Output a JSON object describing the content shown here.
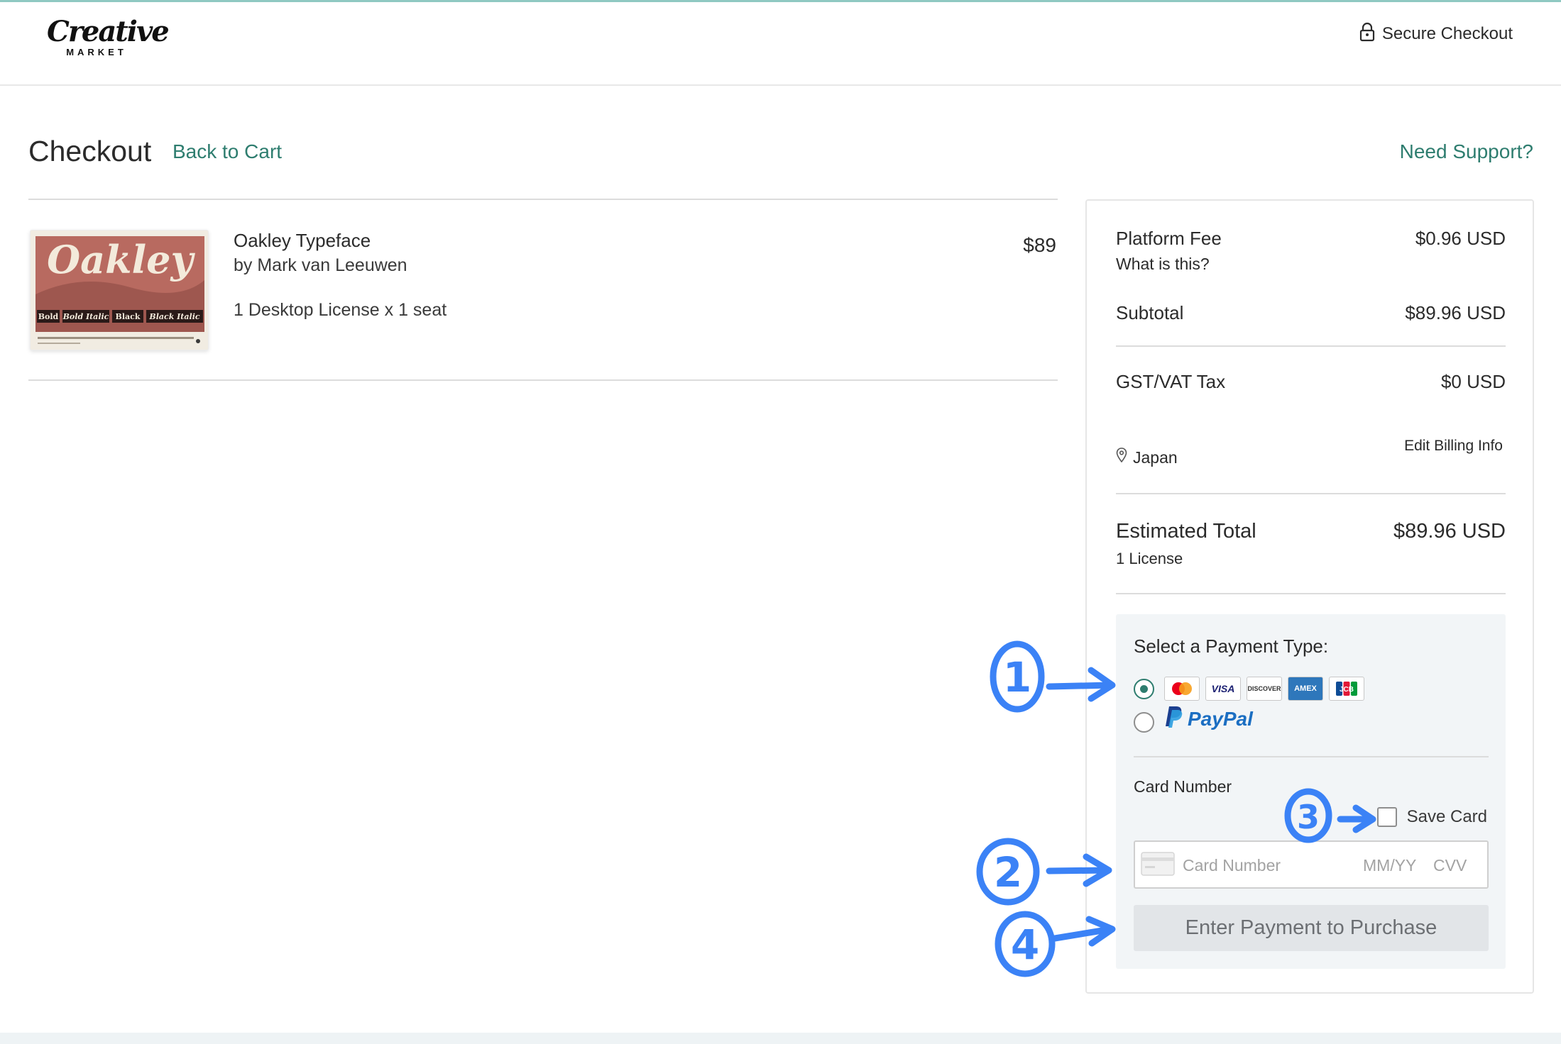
{
  "header": {
    "logo_main": "Creative",
    "logo_sub": "MARKET",
    "secure_label": "Secure Checkout"
  },
  "checkout": {
    "title": "Checkout",
    "back_link": "Back to Cart",
    "support_link": "Need Support?"
  },
  "item": {
    "name": "Oakley Typeface",
    "author": "by Mark van Leeuwen",
    "license": "1 Desktop License x 1 seat",
    "price": "$89",
    "thumbnail": {
      "title": "Oakley",
      "styles": [
        "Bold",
        "Bold Italic",
        "Black",
        "Black Italic"
      ]
    }
  },
  "summary": {
    "platform_fee_label": "Platform Fee",
    "platform_fee_value": "$0.96 USD",
    "what_is_this": "What is this?",
    "subtotal_label": "Subtotal",
    "subtotal_value": "$89.96 USD",
    "tax_label": "GST/VAT Tax",
    "tax_value": "$0 USD",
    "location": "Japan",
    "edit_billing": "Edit Billing Info",
    "total_label": "Estimated Total",
    "total_value": "$89.96 USD",
    "license_count": "1 License"
  },
  "payment": {
    "title": "Select a Payment Type:",
    "options": [
      {
        "id": "card",
        "selected": true,
        "brands": [
          "mastercard",
          "VISA",
          "DISCOVER",
          "AMEX",
          "JCB"
        ]
      },
      {
        "id": "paypal",
        "selected": false,
        "label": "PayPal"
      }
    ],
    "card_number_label": "Card Number",
    "save_card_label": "Save Card",
    "card_placeholder": "Card Number",
    "expiry_placeholder": "MM/YY",
    "cvv_placeholder": "CVV",
    "purchase_button": "Enter Payment to Purchase"
  },
  "annotations": [
    "1",
    "2",
    "3",
    "4"
  ],
  "colors": {
    "accent": "#2e7d6f",
    "annotation": "#3b82f6",
    "panel_bg": "#f2f5f7"
  }
}
